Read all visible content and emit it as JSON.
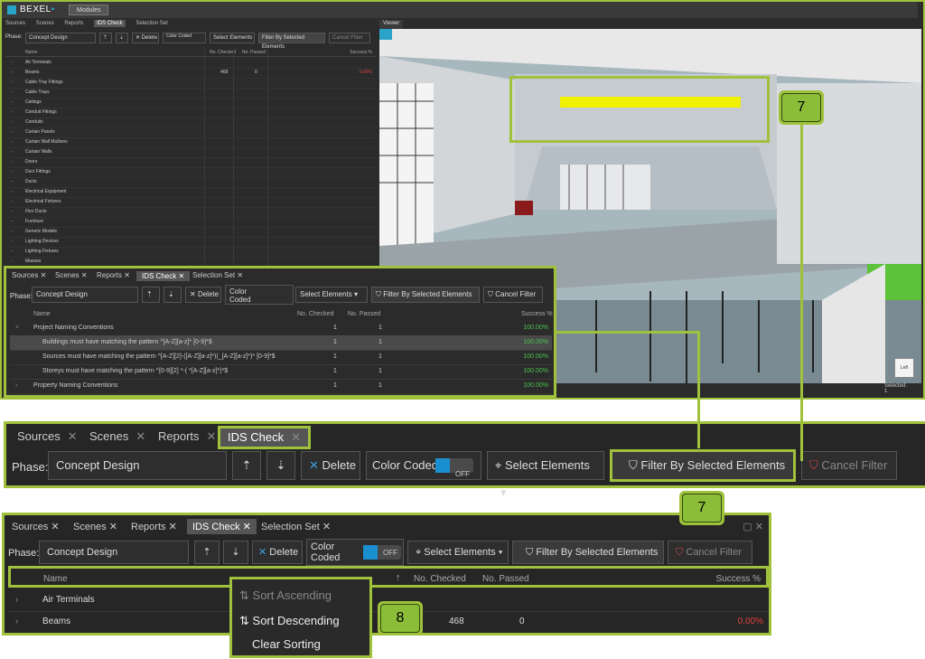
{
  "app": {
    "logo_text": "BEXEL",
    "modules_label": "Modules"
  },
  "top_tabs": [
    "Sources",
    "Scenes",
    "Reports",
    "IDS Check",
    "Selection Set"
  ],
  "viewer_tab": "Viewer",
  "toolbar": {
    "phase_label": "Phase:",
    "phase_value": "Concept Design",
    "delete_label": "Delete",
    "color_coded_label": "Color Coded",
    "toggle_state": "OFF",
    "select_elements_label": "Select Elements",
    "filter_label": "Filter By Selected Elements",
    "cancel_filter_label": "Cancel Filter"
  },
  "grid": {
    "columns": [
      "Name",
      "No. Checked",
      "No. Passed",
      "Success %"
    ],
    "top_rows": [
      {
        "name": "Air Terminals",
        "checked": "",
        "passed": "",
        "success": ""
      },
      {
        "name": "Beams",
        "checked": "468",
        "passed": "0",
        "success": "0.00%"
      },
      {
        "name": "Cable Tray Fittings",
        "checked": "",
        "passed": "",
        "success": ""
      },
      {
        "name": "Cable Trays",
        "checked": "",
        "passed": "",
        "success": ""
      },
      {
        "name": "Ceilings",
        "checked": "",
        "passed": "",
        "success": ""
      },
      {
        "name": "Conduit Fittings",
        "checked": "",
        "passed": "",
        "success": ""
      },
      {
        "name": "Conduits",
        "checked": "",
        "passed": "",
        "success": ""
      },
      {
        "name": "Curtain Panels",
        "checked": "",
        "passed": "",
        "success": ""
      },
      {
        "name": "Curtain Wall Mullions",
        "checked": "",
        "passed": "",
        "success": ""
      },
      {
        "name": "Curtain Walls",
        "checked": "",
        "passed": "",
        "success": ""
      },
      {
        "name": "Doors",
        "checked": "",
        "passed": "",
        "success": ""
      },
      {
        "name": "Duct Fittings",
        "checked": "",
        "passed": "",
        "success": ""
      },
      {
        "name": "Ducts",
        "checked": "",
        "passed": "",
        "success": ""
      },
      {
        "name": "Electrical Equipment",
        "checked": "",
        "passed": "",
        "success": ""
      },
      {
        "name": "Electrical Fixtures",
        "checked": "",
        "passed": "",
        "success": ""
      },
      {
        "name": "Flex Ducts",
        "checked": "",
        "passed": "",
        "success": ""
      },
      {
        "name": "Furniture",
        "checked": "",
        "passed": "",
        "success": ""
      },
      {
        "name": "Generic Models",
        "checked": "",
        "passed": "",
        "success": ""
      },
      {
        "name": "Lighting Devices",
        "checked": "",
        "passed": "",
        "success": ""
      },
      {
        "name": "Lighting Fixtures",
        "checked": "",
        "passed": "",
        "success": ""
      },
      {
        "name": "Masses",
        "checked": "",
        "passed": "",
        "success": ""
      }
    ],
    "inset_rows": [
      {
        "name": "Project Naming Conventions",
        "checked": "1",
        "passed": "1",
        "success": "100.00%"
      },
      {
        "name": "Buildings must have matching the pattern ^[A-Z][a-z]* [0-9]*$",
        "checked": "1",
        "passed": "1",
        "success": "100.00%"
      },
      {
        "name": "Sources must have matching the pattern ^[A-Z][2]-([A-Z][a-z]*)(_[A-Z][a-z]*)* [0-9]*$",
        "checked": "1",
        "passed": "1",
        "success": "100.00%"
      },
      {
        "name": "Storeys must have matching the pattern ^[0-9][2] *-( *[A-Z][a-z]*)*$",
        "checked": "1",
        "passed": "1",
        "success": "100.00%"
      },
      {
        "name": "Property Naming Conventions",
        "checked": "1",
        "passed": "1",
        "success": "100.00%"
      }
    ],
    "bottom_rows": [
      {
        "name": "Air Terminals",
        "checked": "",
        "passed": "",
        "success": ""
      },
      {
        "name": "Beams",
        "checked": "468",
        "passed": "0",
        "success": "0.00%"
      }
    ]
  },
  "sort_menu": [
    "Sort Ascending",
    "Sort Descending",
    "Clear Sorting"
  ],
  "callouts": [
    "7",
    "7",
    "8"
  ],
  "viewer_status": {
    "selected_label": "Selected:",
    "selected_count": "1"
  },
  "colors": {
    "accent": "#9fc13c",
    "panel": "#2b2b2b",
    "toggle": "#1a8fd0",
    "fail": "#e04040",
    "pass": "#4ac24a"
  }
}
